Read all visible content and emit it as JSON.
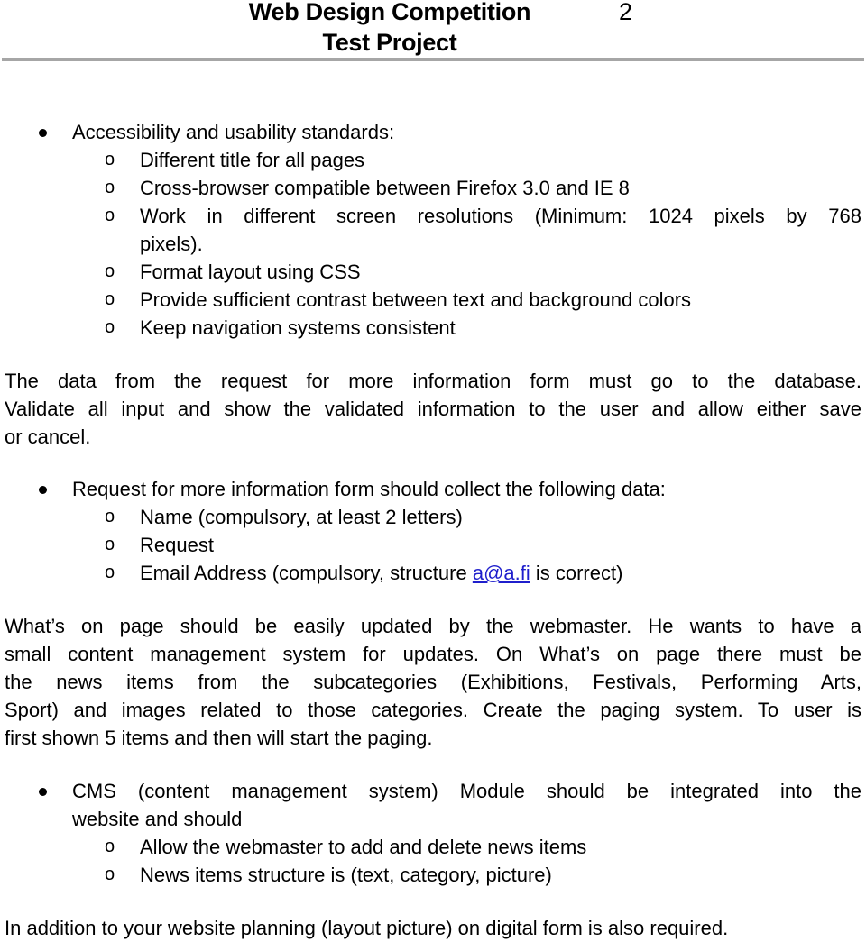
{
  "header": {
    "title_line1": "Web Design Competition",
    "title_line2": "Test Project",
    "page_number": "2"
  },
  "section1": {
    "bullet": "Accessibility and usability standards:",
    "items": [
      "Different title for all pages",
      "Cross-browser compatible between Firefox 3.0 and IE 8",
      "Work in different screen resolutions (Minimum: 1024 pixels by 768",
      "pixels).",
      "Format layout using CSS",
      "Provide sufficient contrast between text and background colors",
      "Keep navigation systems consistent"
    ]
  },
  "paragraph1": {
    "line1": "The data from the request for more information form must go to the database.",
    "line2": "Validate all input and show the validated information to the user and allow either save",
    "line3": "or cancel."
  },
  "section2": {
    "bullet": "Request for more information form should collect the following data:",
    "items": [
      "Name (compulsory, at least 2 letters)",
      "Request"
    ],
    "email_item": {
      "prefix": "Email Address (compulsory, structure ",
      "link_text": "a@a.fi",
      "suffix": " is correct)"
    }
  },
  "paragraph2": {
    "lines": [
      "What’s on page should be easily updated by the webmaster. He wants to have a",
      "small content management system for updates. On What’s on page there must be",
      "the news items from the subcategories (Exhibitions, Festivals, Performing Arts,",
      "Sport) and images related to those categories. Create the paging system. To user is",
      "first shown 5 items and then will start the paging."
    ]
  },
  "section3": {
    "bullet_line1": "CMS (content management system) Module should be integrated into the",
    "bullet_line2": "website and should",
    "items": [
      "Allow the webmaster to add and delete news items",
      "News items structure is (text, category, picture)"
    ]
  },
  "paragraph3": {
    "text": "In addition to your website planning (layout picture) on digital form is also required."
  },
  "colors": {
    "link": "#1f1fcc",
    "rule": "#a6a6a6",
    "text": "#000000"
  },
  "icons": {
    "bullet": "filled-circle-bullet",
    "sub_bullet": "hollow-o-bullet"
  }
}
